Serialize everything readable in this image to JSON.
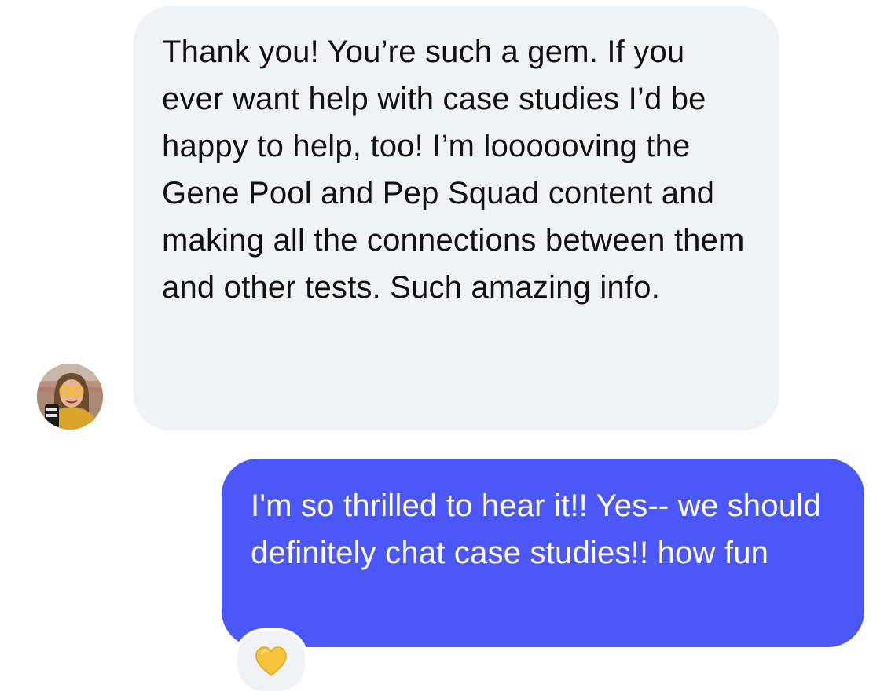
{
  "conversation": {
    "incoming_message": {
      "text": "Thank you! You’re such a gem. If you ever want help with case studies I’d be happy to help, too! I’m loooooving the Gene Pool and Pep Squad content and making all the connections between them and other tests. Such amazing info."
    },
    "outgoing_message": {
      "text": "I'm so thrilled to hear it!! Yes-- we should definitely chat case studies!! how fun",
      "reaction": "yellow-heart-icon"
    }
  },
  "colors": {
    "incoming_bubble": "#f1f2f6",
    "outgoing_bubble": "#4b57f8",
    "reaction_heart": "#f6c33b"
  }
}
